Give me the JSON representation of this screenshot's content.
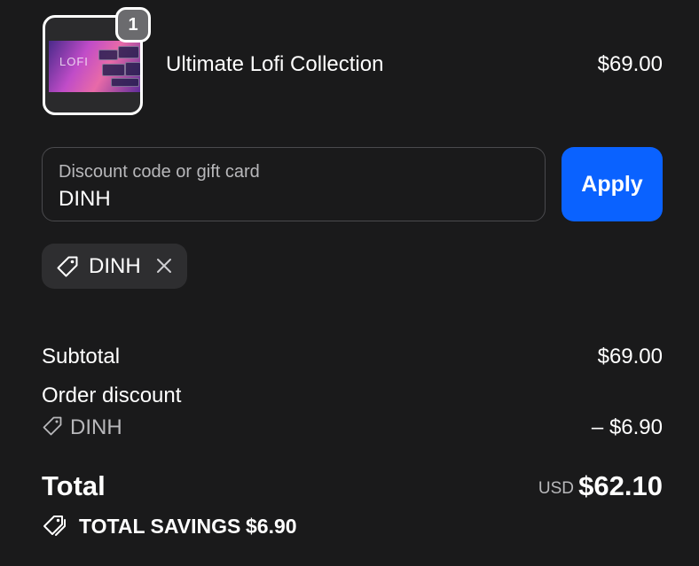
{
  "line_item": {
    "name": "Ultimate Lofi Collection",
    "price": "$69.00",
    "quantity": "1",
    "thumbnail_text": "LOFI"
  },
  "discount": {
    "placeholder": "Discount code or gift card",
    "value": "DINH",
    "apply_label": "Apply",
    "applied_code": "DINH",
    "remove_icon": "close-icon",
    "tag_icon": "tag-icon"
  },
  "summary": {
    "subtotal_label": "Subtotal",
    "subtotal_value": "$69.00",
    "order_discount_label": "Order discount",
    "discount_code": "DINH",
    "discount_value": "– $6.90",
    "total_label": "Total",
    "currency": "USD",
    "total_value": "$62.10",
    "savings_label": "TOTAL SAVINGS",
    "savings_value": "$6.90"
  },
  "colors": {
    "background": "#1a1a1b",
    "accent": "#0a62ff",
    "chip": "#2e2e30",
    "muted_text": "#b8b8bb"
  }
}
